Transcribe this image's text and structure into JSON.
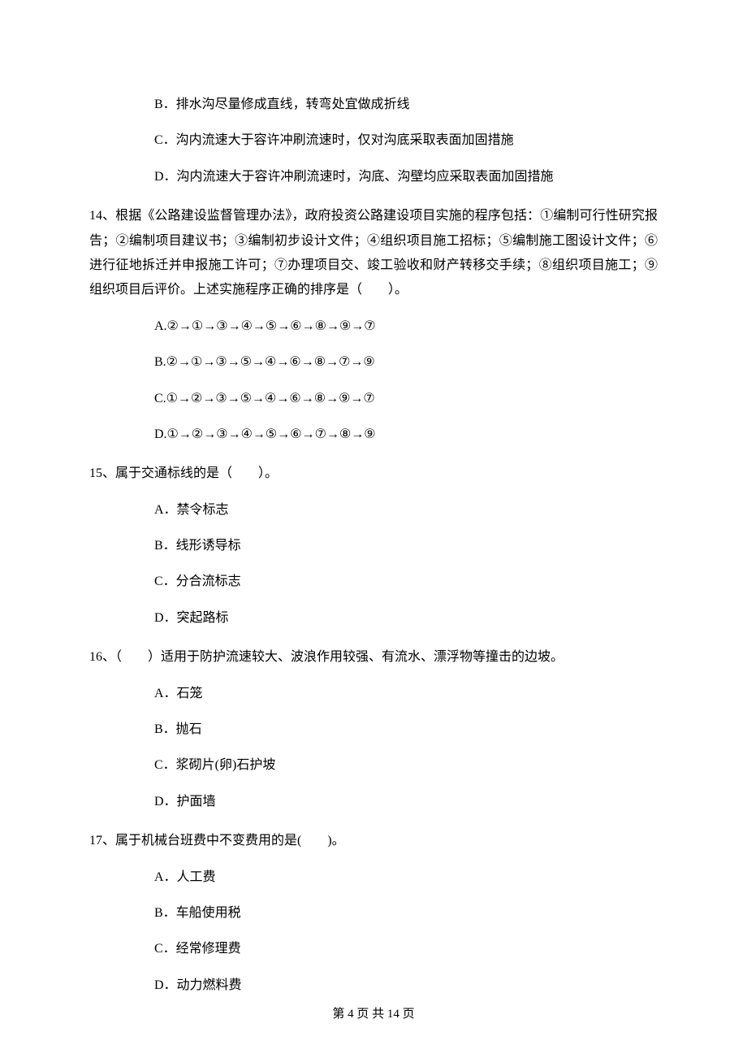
{
  "q13": {
    "options": {
      "B": "B．排水沟尽量修成直线，转弯处宜做成折线",
      "C": "C．沟内流速大于容许冲刷流速时，仅对沟底采取表面加固措施",
      "D": "D．沟内流速大于容许冲刷流速时，沟底、沟壁均应采取表面加固措施"
    }
  },
  "q14": {
    "stem": "14、根据《公路建设监督管理办法》，政府投资公路建设项目实施的程序包括：①编制可行性研究报告；②编制项目建议书；③编制初步设计文件；④组织项目施工招标；⑤编制施工图设计文件；⑥进行征地拆迁并申报施工许可；⑦办理项目交、竣工验收和财产转移交手续；⑧组织项目施工；⑨组织项目后评价。上述实施程序正确的排序是（　　）。",
    "options": {
      "A": "A.②→①→③→④→⑤→⑥→⑧→⑨→⑦",
      "B": "B.②→①→③→⑤→④→⑥→⑧→⑦→⑨",
      "C": "C.①→②→③→⑤→④→⑥→⑧→⑨→⑦",
      "D": "D.①→②→③→④→⑤→⑥→⑦→⑧→⑨"
    }
  },
  "q15": {
    "stem": "15、属于交通标线的是（　　）。",
    "options": {
      "A": "A．禁令标志",
      "B": "B．线形诱导标",
      "C": "C．分合流标志",
      "D": "D．突起路标"
    }
  },
  "q16": {
    "stem": "16、（　　）适用于防护流速较大、波浪作用较强、有流水、漂浮物等撞击的边坡。",
    "options": {
      "A": "A．石笼",
      "B": "B．抛石",
      "C": "C．浆砌片(卵)石护坡",
      "D": "D．护面墙"
    }
  },
  "q17": {
    "stem": "17、属于机械台班费中不变费用的是(　　)。",
    "options": {
      "A": "A．人工费",
      "B": "B．车船使用税",
      "C": "C．经常修理费",
      "D": "D．动力燃料费"
    }
  },
  "footer": "第 4 页 共 14 页"
}
